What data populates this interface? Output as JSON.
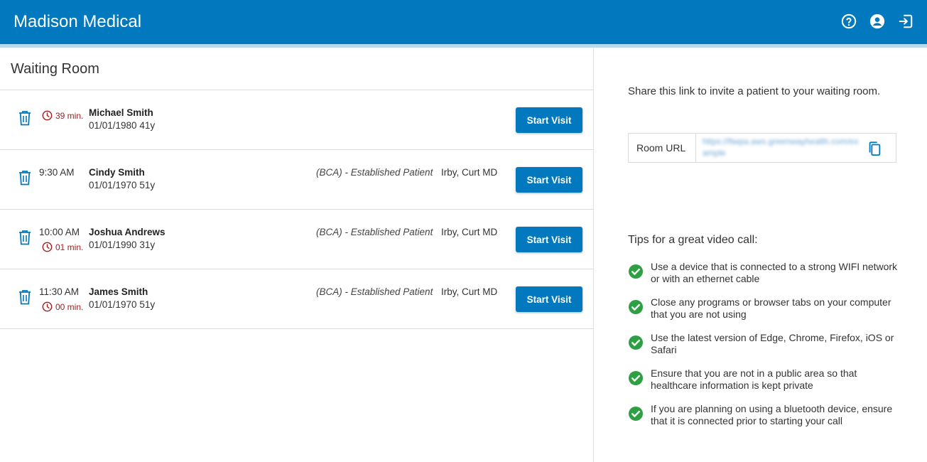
{
  "app": {
    "title": "Madison Medical"
  },
  "header_icons": [
    "help-icon",
    "account-icon",
    "logout-icon"
  ],
  "waiting_room": {
    "title": "Waiting Room",
    "start_label": "Start Visit",
    "patients": [
      {
        "time": "",
        "wait": "39 min.",
        "name": "Michael Smith",
        "dob": "01/01/1980 41y",
        "visit_type": "",
        "provider": ""
      },
      {
        "time": "9:30 AM",
        "wait": "",
        "name": "Cindy Smith",
        "dob": "01/01/1970 51y",
        "visit_type": "(BCA) - Established Patient",
        "provider": "Irby, Curt MD"
      },
      {
        "time": "10:00 AM",
        "wait": "01 min.",
        "name": "Joshua Andrews",
        "dob": "01/01/1990 31y",
        "visit_type": "(BCA) - Established Patient",
        "provider": "Irby, Curt MD"
      },
      {
        "time": "11:30 AM",
        "wait": "00 min.",
        "name": "James Smith",
        "dob": "01/01/1970 51y",
        "visit_type": "(BCA) - Established Patient",
        "provider": "Irby, Curt MD"
      }
    ]
  },
  "invite": {
    "text": "Share this link to invite a patient to your waiting room.",
    "url_label": "Room URL",
    "url_value": "https://ftwpa.aws.greenwayhealth.com/example"
  },
  "tips": {
    "title": "Tips for a great video call:",
    "items": [
      "Use a device that is connected to a strong WIFI network or with an ethernet cable",
      "Close any programs or browser tabs on your computer that you are not using",
      "Use the latest version of Edge, Chrome, Firefox, iOS or Safari",
      "Ensure that you are not in a public area so that healthcare information is kept private",
      "If you are planning on using a bluetooth device, ensure that it is connected prior to starting your call"
    ]
  },
  "colors": {
    "brand": "#0279be",
    "wait": "#a21d1d",
    "check": "#2ea043"
  }
}
